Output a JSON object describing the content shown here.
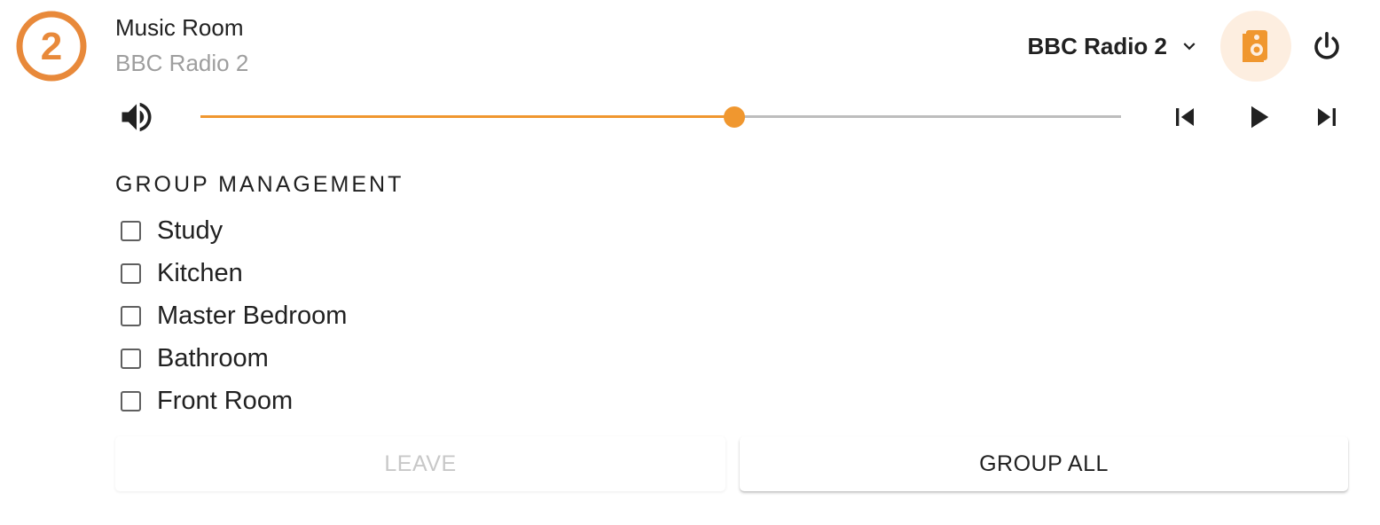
{
  "player": {
    "name": "Music Room",
    "state": "BBC Radio 2",
    "logo_icon": "bbc-radio-2-logo",
    "logo_text": "2",
    "accent_color": "#f0972f",
    "logo_color": "#e8893a"
  },
  "source": {
    "selected": "BBC Radio 2",
    "chevron_icon": "chevron-down-icon"
  },
  "speaker_button": {
    "icon": "speaker-icon",
    "background": "#fdeee0"
  },
  "power_button": {
    "icon": "power-icon"
  },
  "volume": {
    "icon": "volume-high-icon",
    "level": 0.58
  },
  "transport": {
    "previous_icon": "skip-previous-icon",
    "play_icon": "play-icon",
    "next_icon": "skip-next-icon"
  },
  "group_management": {
    "heading": "GROUP MANAGEMENT",
    "members": [
      {
        "label": "Study",
        "checked": false
      },
      {
        "label": "Kitchen",
        "checked": false
      },
      {
        "label": "Master Bedroom",
        "checked": false
      },
      {
        "label": "Bathroom",
        "checked": false
      },
      {
        "label": "Front Room",
        "checked": false
      }
    ],
    "leave_label": "LEAVE",
    "leave_disabled": true,
    "group_all_label": "GROUP ALL"
  }
}
